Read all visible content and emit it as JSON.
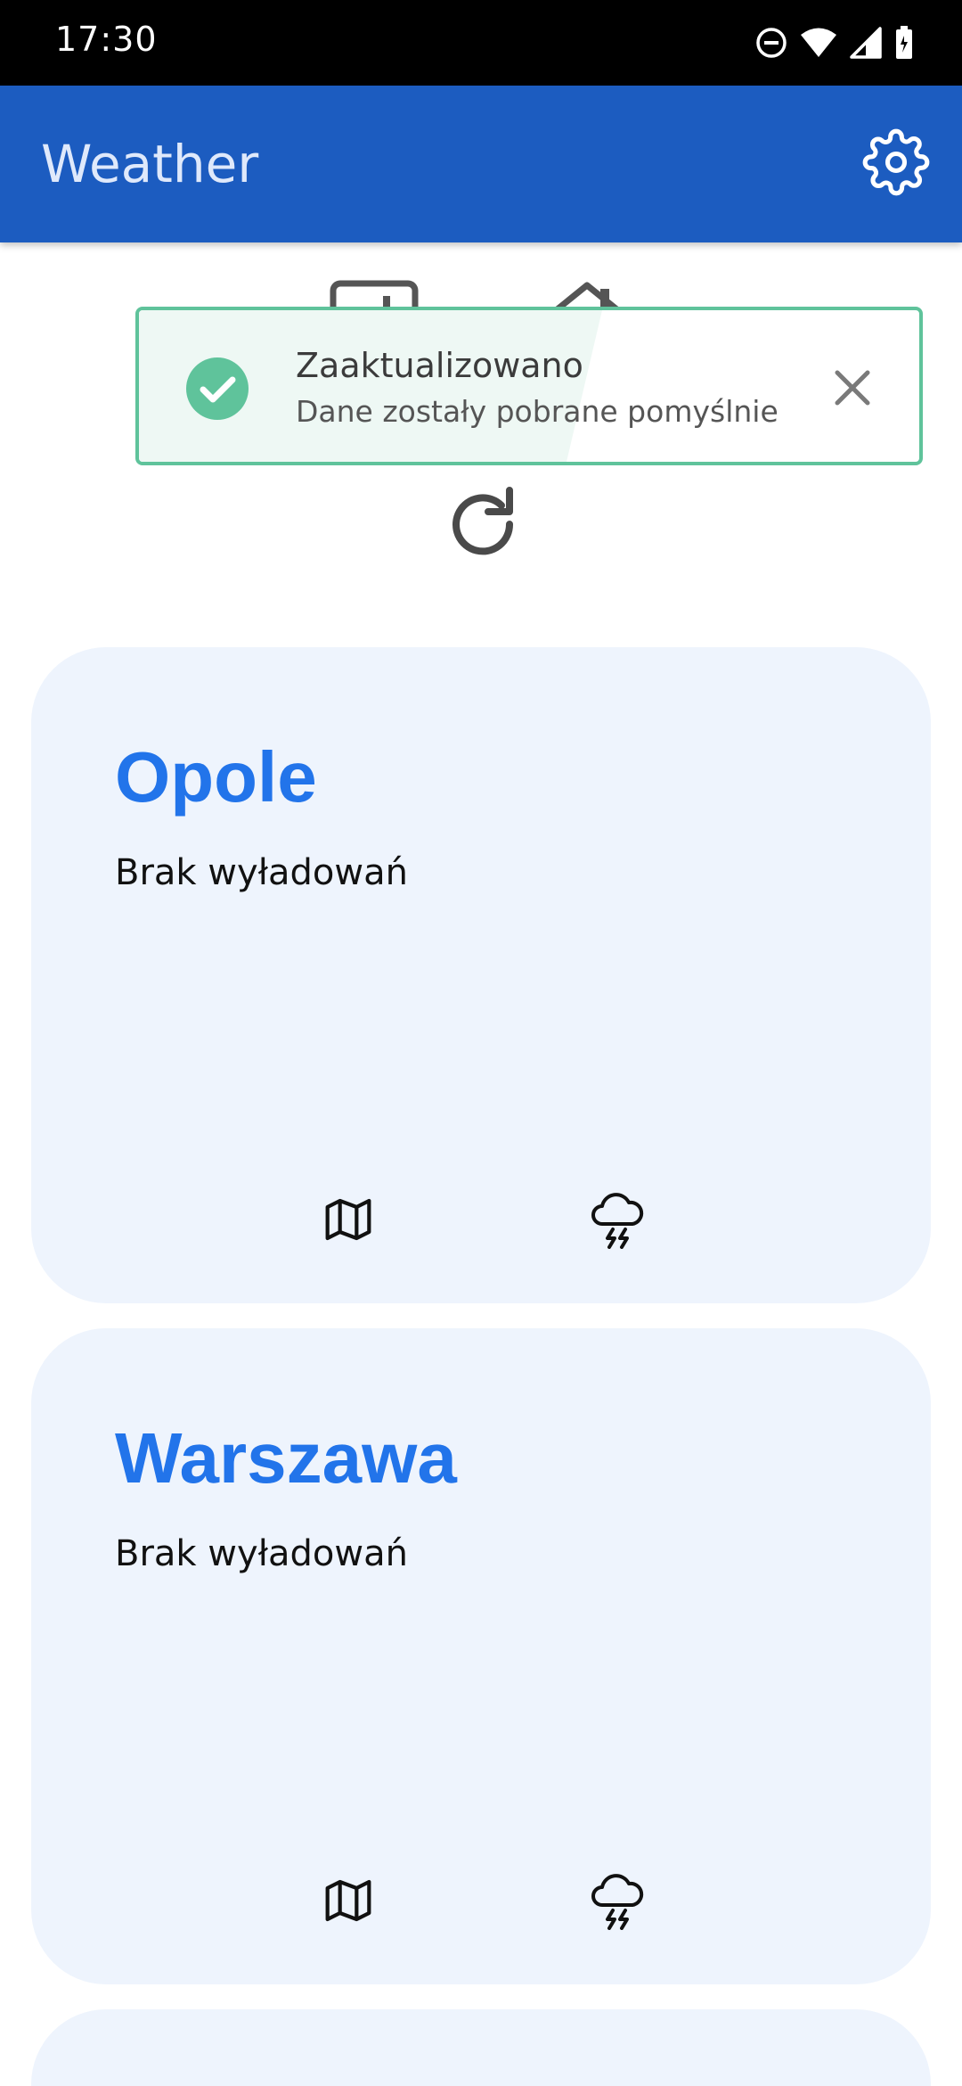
{
  "status_bar": {
    "time": "17:30",
    "icons": [
      "do-not-disturb-icon",
      "wifi-icon",
      "cellular-signal-icon",
      "battery-icon"
    ]
  },
  "app_bar": {
    "title": "Weather",
    "settings_icon": "gear-icon",
    "background_color": "#1c5cc0"
  },
  "toolbar": {
    "icons": [
      "calendar-icon",
      "home-icon",
      "refresh-icon"
    ]
  },
  "toast": {
    "title": "Zaaktualizowano",
    "message": "Dane zostały pobrane pomyślnie",
    "status_icon": "check-circle-icon",
    "close_icon": "close-icon",
    "accent_color": "#5fc39b"
  },
  "cities": [
    {
      "name": "Opole",
      "status": "Brak wyładowań",
      "actions": [
        "map-icon",
        "thunderstorm-icon"
      ]
    },
    {
      "name": "Warszawa",
      "status": "Brak wyładowań",
      "actions": [
        "map-icon",
        "thunderstorm-icon"
      ]
    }
  ],
  "colors": {
    "city_name": "#2274ea",
    "card_background": "#eef4fd"
  }
}
